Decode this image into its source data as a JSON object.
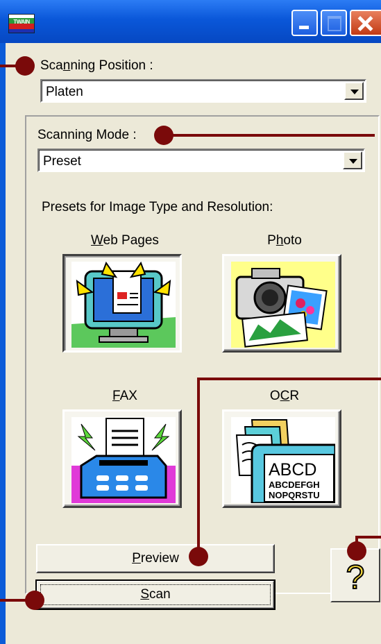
{
  "window": {
    "app_icon_text": "TWAIN",
    "title_buttons": [
      "minimize",
      "maximize",
      "close"
    ]
  },
  "scanning_position": {
    "label_pre": "Sca",
    "label_key": "n",
    "label_post": "ning Position :",
    "value": "Platen"
  },
  "scanning_mode": {
    "label": "Scanning Mode :",
    "value": "Preset"
  },
  "presets": {
    "heading": "Presets for Image Type and Resolution:",
    "items": [
      {
        "key": "W",
        "rest": "eb Pages",
        "icon": "monitor-icon",
        "selected": true
      },
      {
        "pre": "P",
        "key": "h",
        "rest": "oto",
        "icon": "camera-photo-icon",
        "selected": false
      },
      {
        "key": "F",
        "rest": "AX",
        "icon": "fax-machine-icon",
        "selected": false
      },
      {
        "pre": "O",
        "key": "C",
        "rest": "R",
        "icon": "ocr-document-icon",
        "selected": false
      }
    ]
  },
  "ocr_icon_text": {
    "line1": "ABCD",
    "line2": "ABCDEFGH",
    "line3": "NOPQRSTU"
  },
  "buttons": {
    "preview_key": "P",
    "preview_rest": "review",
    "scan_key": "S",
    "scan_rest": "can",
    "help_glyph": "?"
  },
  "colors": {
    "callout": "#7a0a0a",
    "titlebar": "#0a57d9",
    "dialog_bg": "#ece9d8"
  }
}
